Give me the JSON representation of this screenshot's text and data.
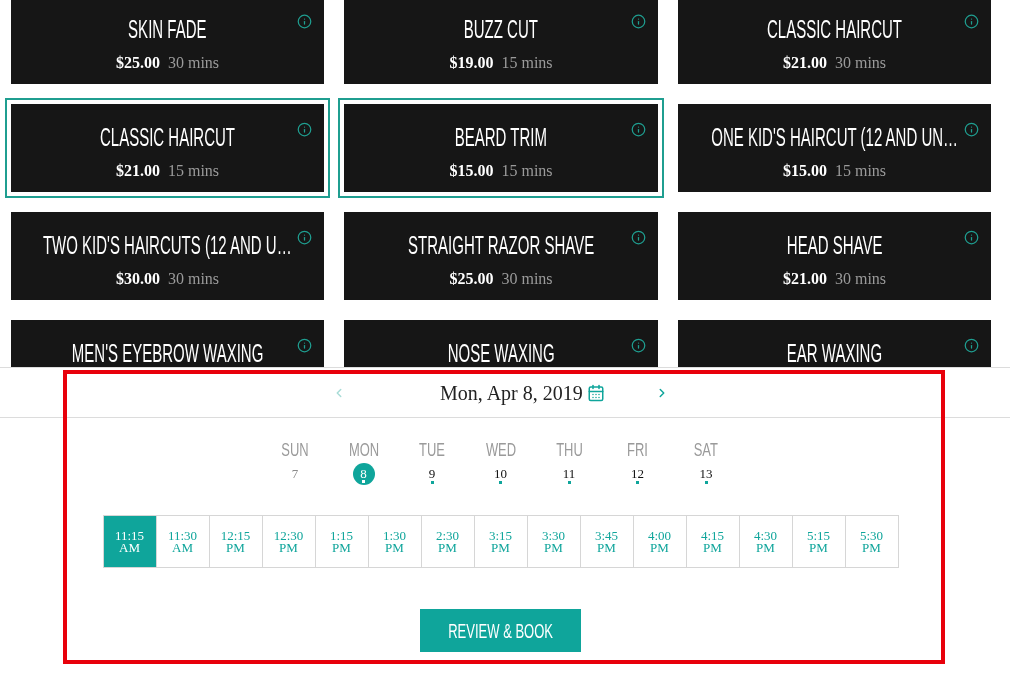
{
  "services": [
    {
      "name": "SKIN FADE",
      "price": "$25.00",
      "duration": "30 mins",
      "selected": false
    },
    {
      "name": "BUZZ CUT",
      "price": "$19.00",
      "duration": "15 mins",
      "selected": false
    },
    {
      "name": "CLASSIC HAIRCUT",
      "price": "$21.00",
      "duration": "30 mins",
      "selected": false
    },
    {
      "name": "CLASSIC HAIRCUT",
      "price": "$21.00",
      "duration": "15 mins",
      "selected": true
    },
    {
      "name": "BEARD TRIM",
      "price": "$15.00",
      "duration": "15 mins",
      "selected": true
    },
    {
      "name": "ONE KID'S HAIRCUT (12 AND UN…",
      "price": "$15.00",
      "duration": "15 mins",
      "selected": false
    },
    {
      "name": "TWO KID'S HAIRCUTS (12 AND U…",
      "price": "$30.00",
      "duration": "30 mins",
      "selected": false
    },
    {
      "name": "STRAIGHT RAZOR SHAVE",
      "price": "$25.00",
      "duration": "30 mins",
      "selected": false
    },
    {
      "name": "HEAD SHAVE",
      "price": "$21.00",
      "duration": "30 mins",
      "selected": false
    },
    {
      "name": "MEN'S EYEBROW WAXING",
      "selected": false
    },
    {
      "name": "NOSE WAXING",
      "selected": false
    },
    {
      "name": "EAR WAXING",
      "selected": false
    }
  ],
  "date_nav": {
    "label": "Mon, Apr 8, 2019",
    "prev": {
      "disabled": true
    },
    "next": {
      "disabled": false
    }
  },
  "days": [
    {
      "name": "SUN",
      "day": "7",
      "available": false,
      "selected": false
    },
    {
      "name": "MON",
      "day": "8",
      "available": true,
      "selected": true
    },
    {
      "name": "TUE",
      "day": "9",
      "available": true,
      "selected": false
    },
    {
      "name": "WED",
      "day": "10",
      "available": true,
      "selected": false
    },
    {
      "name": "THU",
      "day": "11",
      "available": true,
      "selected": false
    },
    {
      "name": "FRI",
      "day": "12",
      "available": true,
      "selected": false
    },
    {
      "name": "SAT",
      "day": "13",
      "available": true,
      "selected": false
    }
  ],
  "slots": [
    {
      "time": "11:15",
      "period": "AM",
      "selected": true
    },
    {
      "time": "11:30",
      "period": "AM",
      "selected": false
    },
    {
      "time": "12:15",
      "period": "PM",
      "selected": false
    },
    {
      "time": "12:30",
      "period": "PM",
      "selected": false
    },
    {
      "time": "1:15",
      "period": "PM",
      "selected": false
    },
    {
      "time": "1:30",
      "period": "PM",
      "selected": false
    },
    {
      "time": "2:30",
      "period": "PM",
      "selected": false
    },
    {
      "time": "3:15",
      "period": "PM",
      "selected": false
    },
    {
      "time": "3:30",
      "period": "PM",
      "selected": false
    },
    {
      "time": "3:45",
      "period": "PM",
      "selected": false
    },
    {
      "time": "4:00",
      "period": "PM",
      "selected": false
    },
    {
      "time": "4:15",
      "period": "PM",
      "selected": false
    },
    {
      "time": "4:30",
      "period": "PM",
      "selected": false
    },
    {
      "time": "5:15",
      "period": "PM",
      "selected": false
    },
    {
      "time": "5:30",
      "period": "PM",
      "selected": false
    }
  ],
  "action_button": "REVIEW & BOOK"
}
